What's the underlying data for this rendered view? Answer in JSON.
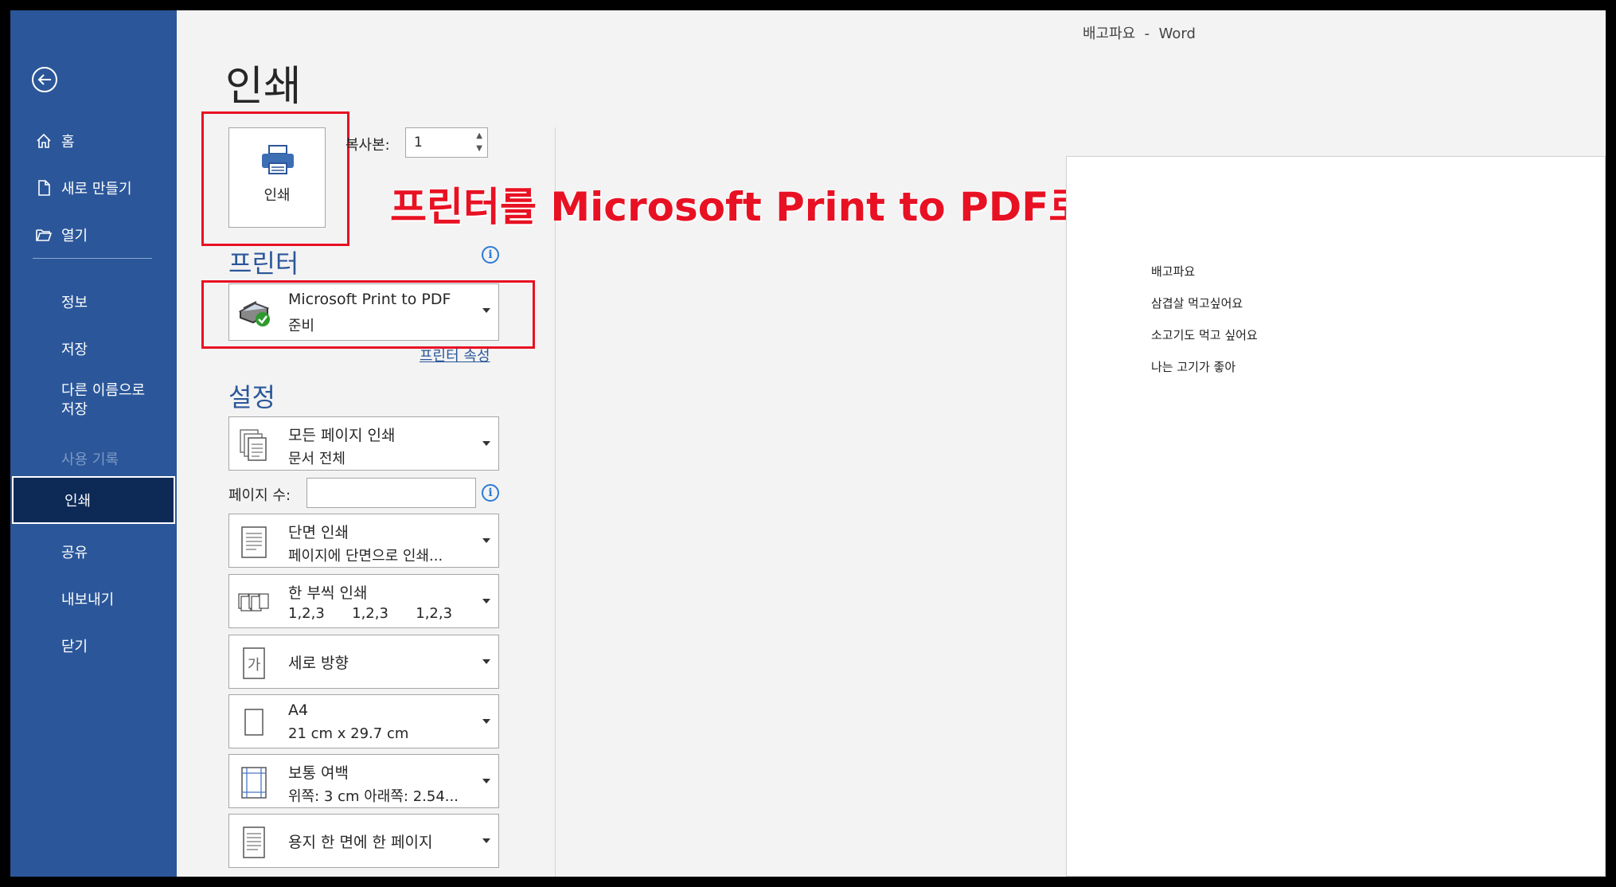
{
  "window": {
    "title": "배고파요  -  Word"
  },
  "sidebar": {
    "back_icon": "back-arrow-icon",
    "items": [
      {
        "label": "홈",
        "icon": "home-icon"
      },
      {
        "label": "새로 만들기",
        "icon": "new-document-icon"
      },
      {
        "label": "열기",
        "icon": "open-folder-icon"
      },
      {
        "label": "정보"
      },
      {
        "label": "저장"
      },
      {
        "label": "다른 이름으로 저장"
      },
      {
        "label": "사용 기록"
      },
      {
        "label": "인쇄"
      },
      {
        "label": "공유"
      },
      {
        "label": "내보내기"
      },
      {
        "label": "닫기"
      }
    ]
  },
  "print": {
    "title": "인쇄",
    "print_button_label": "인쇄",
    "copies_label": "복사본:",
    "copies_value": "1",
    "printer_section": "프린터",
    "printer_name": "Microsoft Print to PDF",
    "printer_status": "준비",
    "printer_properties_link": "프린터 속성",
    "settings_section": "설정",
    "pages_label": "페이지 수:",
    "pages_value": "",
    "settings": [
      {
        "line1": "모든 페이지 인쇄",
        "line2": "문서 전체",
        "icon": "pages-icon"
      },
      {
        "line1": "단면 인쇄",
        "line2": "페이지에 단면으로 인쇄...",
        "icon": "one-sided-icon"
      },
      {
        "line1": "한 부씩 인쇄",
        "line2": "1,2,3      1,2,3      1,2,3",
        "icon": "collate-icon"
      },
      {
        "line1": "세로 방향",
        "line2": "",
        "icon": "portrait-icon"
      },
      {
        "line1": "A4",
        "line2": "21 cm x 29.7 cm",
        "icon": "paper-size-icon"
      },
      {
        "line1": "보통 여백",
        "line2": "위쪽: 3 cm 아래쪽: 2.54...",
        "icon": "margins-icon"
      },
      {
        "line1": "용지 한 면에 한 페이지",
        "line2": "",
        "icon": "pages-per-sheet-icon"
      }
    ]
  },
  "annotation": {
    "text": "프린터를 Microsoft Print to PDF로 설정",
    "color": "#e81123"
  },
  "preview": {
    "lines": [
      "배고파요",
      "삼겹살 먹고싶어요",
      "소고기도 먹고 싶어요",
      "나는 고기가 좋아"
    ]
  },
  "colors": {
    "sidebar": "#2b579a",
    "sidebar_active": "#0d2a57",
    "accent": "#2b579a",
    "annotation": "#e81123"
  }
}
